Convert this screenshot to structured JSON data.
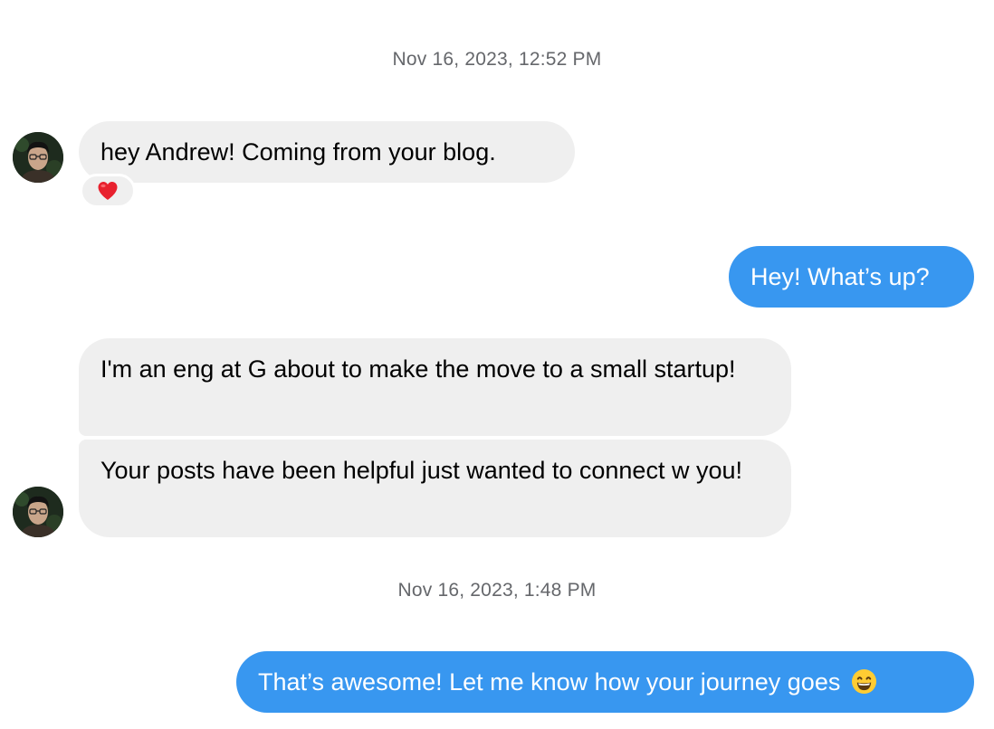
{
  "conversation": {
    "timestamp_1": "Nov 16, 2023, 12:52 PM",
    "timestamp_2": "Nov 16, 2023, 1:48 PM",
    "messages": [
      {
        "direction": "incoming",
        "text": "hey Andrew! Coming from your blog.",
        "reaction": "heart-icon"
      },
      {
        "direction": "outgoing",
        "text": "Hey! What’s up?"
      },
      {
        "direction": "incoming",
        "text": "I'm an eng at G about to make the move to a small startup!"
      },
      {
        "direction": "incoming",
        "text": "Your posts have been helpful just wanted to connect w you!"
      },
      {
        "direction": "outgoing",
        "text": "That’s awesome! Let me know how your journey goes",
        "trailing_emoji": "grinning-face-icon"
      }
    ]
  },
  "colors": {
    "outgoing_bubble": "#3897f0",
    "incoming_bubble": "#efefef",
    "timestamp_text": "#65676b",
    "reaction_heart": "#e8212e"
  }
}
